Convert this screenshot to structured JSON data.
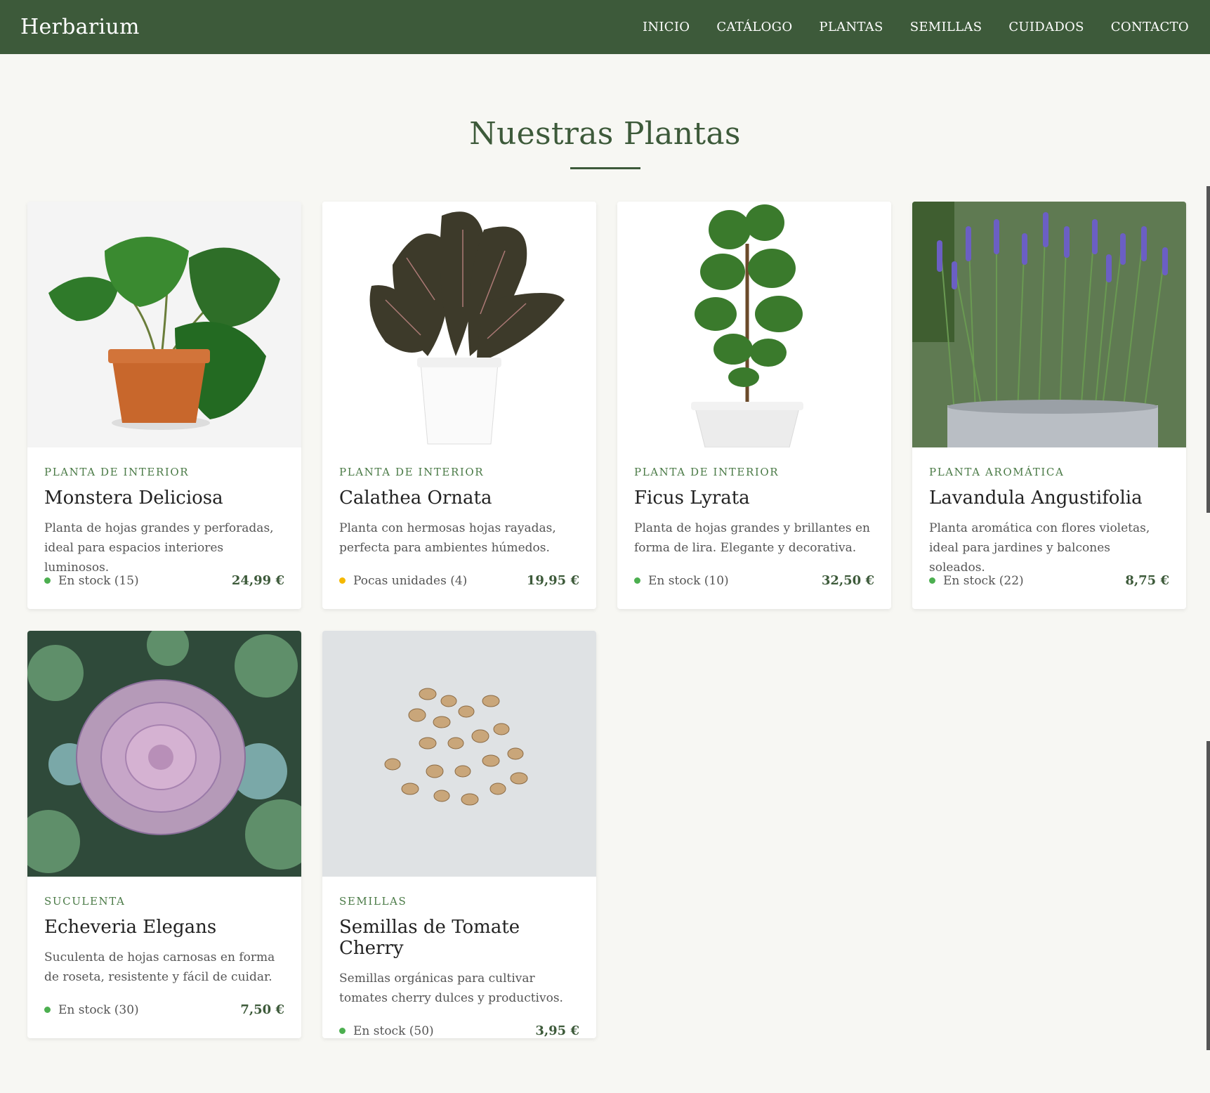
{
  "header": {
    "brand": "Herbarium",
    "nav": [
      "INICIO",
      "CATÁLOGO",
      "PLANTAS",
      "SEMILLAS",
      "CUIDADOS",
      "CONTACTO"
    ]
  },
  "main": {
    "title": "Nuestras Plantas",
    "products": [
      {
        "category": "PLANTA DE INTERIOR",
        "name": "Monstera Deliciosa",
        "description": "Planta de hojas grandes y perforadas, ideal para espacios interiores luminosos.",
        "stock": "En stock (15)",
        "stock_color": "#4caf50",
        "price": "24,99 €",
        "image": "monstera-plant-photo"
      },
      {
        "category": "PLANTA DE INTERIOR",
        "name": "Calathea Ornata",
        "description": "Planta con hermosas hojas rayadas, perfecta para ambientes húmedos.",
        "stock": "Pocas unidades (4)",
        "stock_color": "#f5b800",
        "price": "19,95 €",
        "image": "calathea-plant-photo"
      },
      {
        "category": "PLANTA DE INTERIOR",
        "name": "Ficus Lyrata",
        "description": "Planta de hojas grandes y brillantes en forma de lira. Elegante y decorativa.",
        "stock": "En stock (10)",
        "stock_color": "#4caf50",
        "price": "32,50 €",
        "image": "ficus-plant-photo"
      },
      {
        "category": "PLANTA AROMÁTICA",
        "name": "Lavandula Angustifolia",
        "description": "Planta aromática con flores violetas, ideal para jardines y balcones soleados.",
        "stock": "En stock (22)",
        "stock_color": "#4caf50",
        "price": "8,75 €",
        "image": "lavender-plant-photo"
      },
      {
        "category": "SUCULENTA",
        "name": "Echeveria Elegans",
        "description": "Suculenta de hojas carnosas en forma de roseta, resistente y fácil de cuidar.",
        "stock": "En stock (30)",
        "stock_color": "#4caf50",
        "price": "7,50 €",
        "image": "echeveria-succulent-photo"
      },
      {
        "category": "SEMILLAS",
        "name": "Semillas de Tomate Cherry",
        "description": "Semillas orgánicas para cultivar tomates cherry dulces y productivos.",
        "stock": "En stock (50)",
        "stock_color": "#4caf50",
        "price": "3,95 €",
        "image": "tomato-seeds-photo"
      }
    ]
  },
  "colors": {
    "header_bg": "#3d5a3a",
    "accent": "#3d5a3a",
    "category_text": "#4a7a46",
    "page_bg": "#f7f7f3"
  }
}
